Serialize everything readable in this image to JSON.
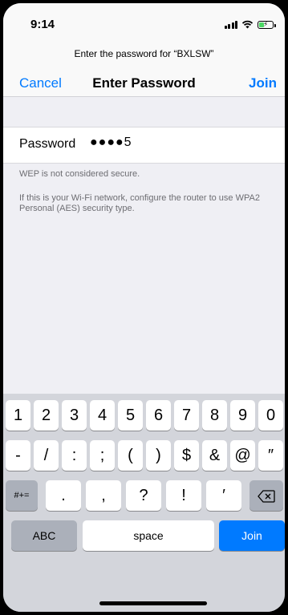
{
  "status_bar": {
    "time": "9:14",
    "icons": [
      "signal-icon",
      "wifi-icon",
      "battery-charging-icon"
    ]
  },
  "nav": {
    "prompt": "Enter the password for “BXLSW”",
    "cancel": "Cancel",
    "title": "Enter Password",
    "join": "Join"
  },
  "password": {
    "label": "Password",
    "value": "●●●●5"
  },
  "notes": {
    "wep_warning": "WEP is not considered secure.",
    "advice": "If this is your Wi-Fi network, configure the router to use WPA2 Personal (AES) security type."
  },
  "keyboard": {
    "row1": [
      "1",
      "2",
      "3",
      "4",
      "5",
      "6",
      "7",
      "8",
      "9",
      "0"
    ],
    "row2": [
      "-",
      "/",
      ":",
      ";",
      "(",
      ")",
      "$",
      "&",
      "@",
      "″"
    ],
    "row3": [
      ".",
      ",",
      "?",
      "!",
      "′"
    ],
    "shift": "#+=",
    "abc": "ABC",
    "space": "space",
    "join": "Join"
  },
  "colors": {
    "accent": "#007aff",
    "keyboard_bg": "#d3d5db"
  }
}
